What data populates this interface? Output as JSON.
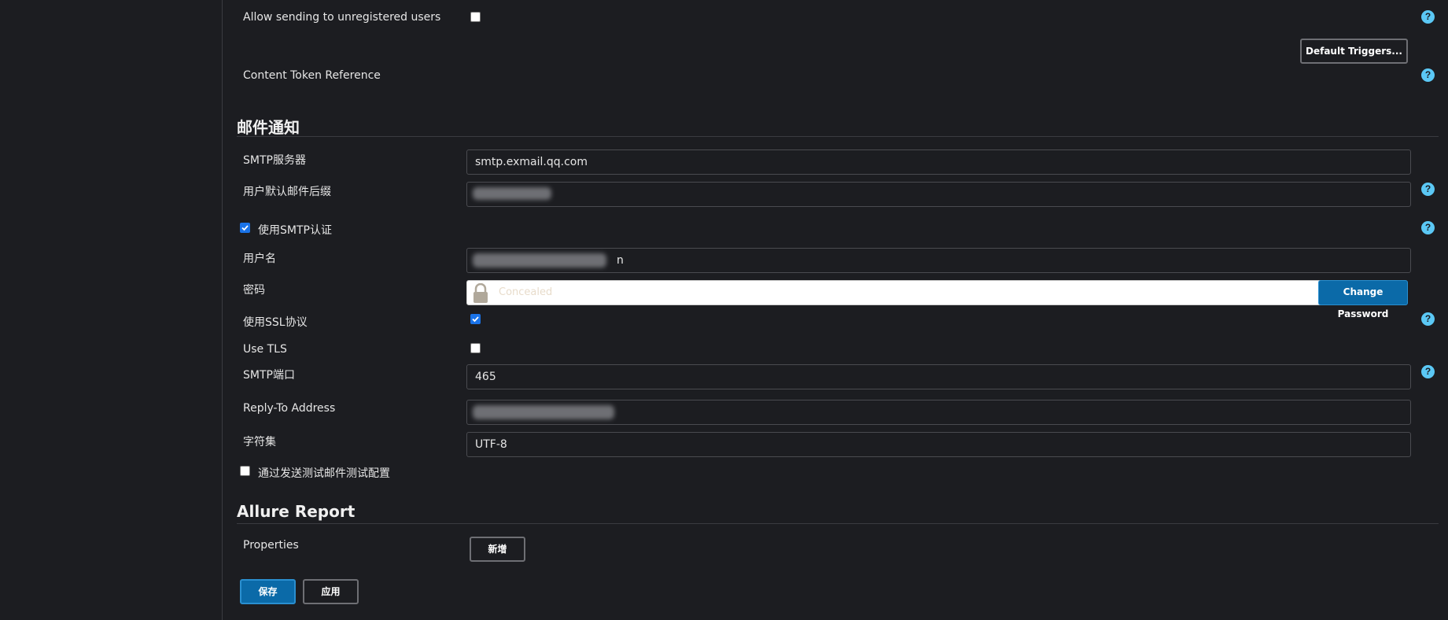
{
  "email_ext": {
    "allow_unregistered_label": "Allow sending to unregistered users",
    "allow_unregistered_checked": false,
    "default_triggers_button": "Default Triggers...",
    "content_token_label": "Content Token Reference"
  },
  "mail_notification": {
    "section_title": "邮件通知",
    "smtp_server_label": "SMTP服务器",
    "smtp_server_value": "smtp.exmail.qq.com",
    "default_suffix_label": "用户默认邮件后缀",
    "default_suffix_value": "",
    "use_smtp_auth_label": "使用SMTP认证",
    "use_smtp_auth_checked": true,
    "username_label": "用户名",
    "username_value": "n",
    "password_label": "密码",
    "password_placeholder": "Concealed",
    "change_password_button": "Change Password",
    "use_ssl_label": "使用SSL协议",
    "use_ssl_checked": true,
    "use_tls_label": "Use TLS",
    "use_tls_checked": false,
    "smtp_port_label": "SMTP端口",
    "smtp_port_value": "465",
    "reply_to_label": "Reply-To Address",
    "reply_to_value": "",
    "charset_label": "字符集",
    "charset_value": "UTF-8",
    "test_config_label": "通过发送测试邮件测试配置",
    "test_config_checked": false
  },
  "allure": {
    "section_title": "Allure Report",
    "properties_label": "Properties",
    "add_button": "新增"
  },
  "footer": {
    "save_button": "保存",
    "apply_button": "应用"
  },
  "icons": {
    "help": "help-icon",
    "lock": "lock-icon",
    "check": "checkmark-icon"
  },
  "colors": {
    "background": "#1c1d21",
    "primary_button": "#0b6aa8",
    "help_icon": "#5bc8f5",
    "checkbox_checked": "#1a73e8"
  }
}
